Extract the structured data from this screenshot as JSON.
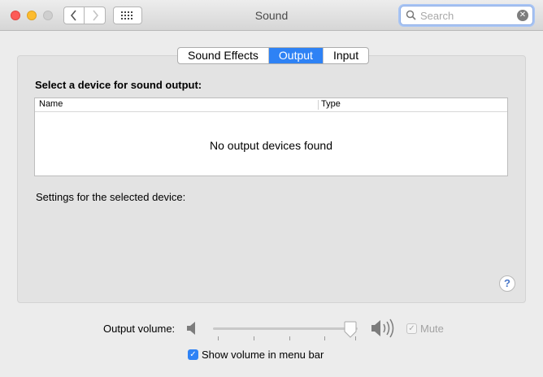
{
  "window": {
    "title": "Sound",
    "search_placeholder": "Search",
    "traffic_lights": [
      "close",
      "minimize",
      "zoom"
    ]
  },
  "tabs": [
    {
      "label": "Sound Effects",
      "active": false
    },
    {
      "label": "Output",
      "active": true
    },
    {
      "label": "Input",
      "active": false
    }
  ],
  "output": {
    "select_label": "Select a device for sound output:",
    "columns": [
      "Name",
      "Type"
    ],
    "empty_message": "No output devices found",
    "settings_label": "Settings for the selected device:",
    "help_label": "?"
  },
  "volume": {
    "label": "Output volume:",
    "level": 0.95,
    "mute_label": "Mute",
    "mute_checked": true,
    "mute_enabled": false
  },
  "menu_bar": {
    "label": "Show volume in menu bar",
    "checked": true
  },
  "colors": {
    "accent": "#2e82f5",
    "close": "#fc5b57",
    "minimize": "#fdbc2f",
    "zoom": "#cfcfcf"
  },
  "icons": [
    "back-chevron-icon",
    "forward-chevron-icon",
    "grid-icon",
    "search-icon",
    "clear-search-icon",
    "speaker-low-icon",
    "speaker-high-icon",
    "help-icon",
    "checkmark-icon"
  ]
}
